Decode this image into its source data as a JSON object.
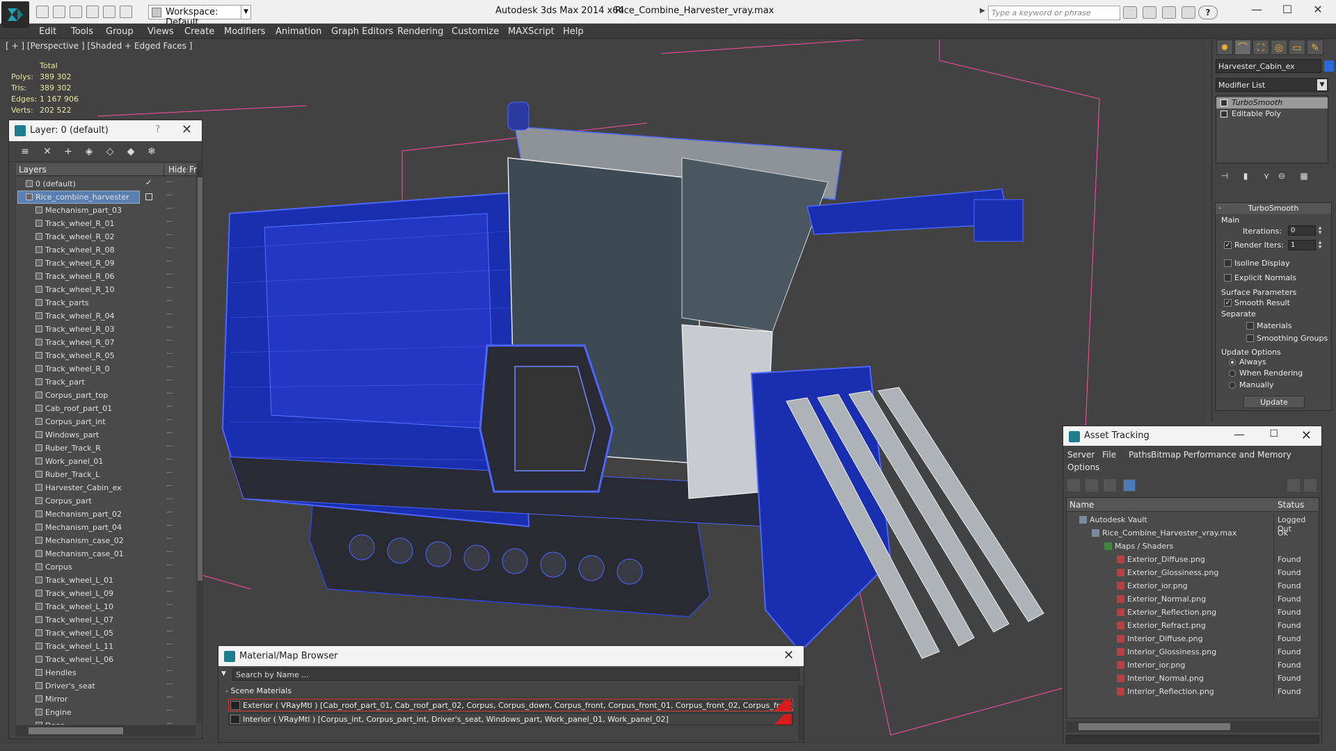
{
  "titlebar": {
    "workspace": "Workspace: Default",
    "app_title": "Autodesk 3ds Max  2014 x64",
    "file_name": "Rice_Combine_Harvester_vray.max",
    "search_placeholder": "Type a keyword or phrase",
    "help_label": "?"
  },
  "menu": [
    "Edit",
    "Tools",
    "Group",
    "Views",
    "Create",
    "Modifiers",
    "Animation",
    "Graph Editors",
    "Rendering",
    "Customize",
    "MAXScript",
    "Help"
  ],
  "viewport": {
    "label": "[ + ] [Perspective ] [Shaded + Edged Faces ]",
    "stats": {
      "header": "Total",
      "rows": [
        {
          "k": "Polys:",
          "v": "389 302"
        },
        {
          "k": "Tris:",
          "v": "389 302"
        },
        {
          "k": "Edges:",
          "v": "1 167 906"
        },
        {
          "k": "Verts:",
          "v": "202 522"
        }
      ]
    }
  },
  "layer_panel": {
    "title": "Layer: 0 (default)",
    "help": "?",
    "col_layers": "Layers",
    "col_hide": "Hide",
    "col_freeze": "Fr",
    "items": [
      {
        "label": "0 (default)",
        "level": 0,
        "checked": true
      },
      {
        "label": "Rice_combine_harvester",
        "level": 0,
        "selected": true
      },
      {
        "label": "Mechanism_part_03",
        "level": 1
      },
      {
        "label": "Track_wheel_R_01",
        "level": 1
      },
      {
        "label": "Track_wheel_R_02",
        "level": 1
      },
      {
        "label": "Track_wheel_R_08",
        "level": 1
      },
      {
        "label": "Track_wheel_R_09",
        "level": 1
      },
      {
        "label": "Track_wheel_R_06",
        "level": 1
      },
      {
        "label": "Track_wheel_R_10",
        "level": 1
      },
      {
        "label": "Track_parts",
        "level": 1
      },
      {
        "label": "Track_wheel_R_04",
        "level": 1
      },
      {
        "label": "Track_wheel_R_03",
        "level": 1
      },
      {
        "label": "Track_wheel_R_07",
        "level": 1
      },
      {
        "label": "Track_wheel_R_05",
        "level": 1
      },
      {
        "label": "Track_wheel_R_0",
        "level": 1
      },
      {
        "label": "Track_part",
        "level": 1
      },
      {
        "label": "Corpus_part_top",
        "level": 1
      },
      {
        "label": "Cab_roof_part_01",
        "level": 1
      },
      {
        "label": "Corpus_part_int",
        "level": 1
      },
      {
        "label": "Windows_part",
        "level": 1
      },
      {
        "label": "Ruber_Track_R",
        "level": 1
      },
      {
        "label": "Work_panel_01",
        "level": 1
      },
      {
        "label": "Ruber_Track_L",
        "level": 1
      },
      {
        "label": "Harvester_Cabin_ex",
        "level": 1
      },
      {
        "label": "Corpus_part",
        "level": 1
      },
      {
        "label": "Mechanism_part_02",
        "level": 1
      },
      {
        "label": "Mechanism_part_04",
        "level": 1
      },
      {
        "label": "Mechanism_case_02",
        "level": 1
      },
      {
        "label": "Mechanism_case_01",
        "level": 1
      },
      {
        "label": "Corpus",
        "level": 1
      },
      {
        "label": "Track_wheel_L_01",
        "level": 1
      },
      {
        "label": "Track_wheel_L_09",
        "level": 1
      },
      {
        "label": "Track_wheel_L_10",
        "level": 1
      },
      {
        "label": "Track_wheel_L_07",
        "level": 1
      },
      {
        "label": "Track_wheel_L_05",
        "level": 1
      },
      {
        "label": "Track_wheel_L_11",
        "level": 1
      },
      {
        "label": "Track_wheel_L_06",
        "level": 1
      },
      {
        "label": "Hendles",
        "level": 1
      },
      {
        "label": "Driver's_seat",
        "level": 1
      },
      {
        "label": "Mirror",
        "level": 1
      },
      {
        "label": "Engine",
        "level": 1
      },
      {
        "label": "Door",
        "level": 1
      }
    ]
  },
  "command_panel": {
    "object_name": "Harvester_Cabin_ex",
    "modifier_list": "Modifier List",
    "stack": [
      {
        "label": "TurboSmooth",
        "active": true
      },
      {
        "label": "Editable Poly",
        "active": false
      }
    ],
    "turbosmooth": {
      "title": "TurboSmooth",
      "main_group": "Main",
      "iterations_label": "Iterations:",
      "iterations_value": "0",
      "render_iters_label": "Render Iters:",
      "render_iters_value": "1",
      "isoline_label": "Isoline Display",
      "explicit_normals_label": "Explicit Normals",
      "surface_group": "Surface Parameters",
      "smooth_result_label": "Smooth Result",
      "separate_label": "Separate",
      "materials_label": "Materials",
      "smoothing_groups_label": "Smoothing Groups",
      "update_group": "Update Options",
      "always_label": "Always",
      "when_rendering_label": "When Rendering",
      "manually_label": "Manually",
      "update_button": "Update"
    }
  },
  "asset_tracking": {
    "title": "Asset Tracking",
    "menu": [
      "Server",
      "File",
      "Paths",
      "Bitmap Performance and Memory",
      "Options"
    ],
    "col_name": "Name",
    "col_status": "Status",
    "rows": [
      {
        "name": "Autodesk Vault",
        "status": "Logged Out",
        "indent": 1,
        "icon": "vault-icon"
      },
      {
        "name": "Rice_Combine_Harvester_vray.max",
        "status": "Ok",
        "indent": 2,
        "icon": "max-file-icon"
      },
      {
        "name": "Maps / Shaders",
        "status": "",
        "indent": 3,
        "icon": "maps-icon"
      },
      {
        "name": "Exterior_Diffuse.png",
        "status": "Found",
        "indent": 4,
        "icon": "png-icon"
      },
      {
        "name": "Exterior_Glossiness.png",
        "status": "Found",
        "indent": 4,
        "icon": "png-icon"
      },
      {
        "name": "Exterior_ior.png",
        "status": "Found",
        "indent": 4,
        "icon": "png-icon"
      },
      {
        "name": "Exterior_Normal.png",
        "status": "Found",
        "indent": 4,
        "icon": "png-icon"
      },
      {
        "name": "Exterior_Reflection.png",
        "status": "Found",
        "indent": 4,
        "icon": "png-icon"
      },
      {
        "name": "Exterior_Refract.png",
        "status": "Found",
        "indent": 4,
        "icon": "png-icon"
      },
      {
        "name": "Interior_Diffuse.png",
        "status": "Found",
        "indent": 4,
        "icon": "png-icon"
      },
      {
        "name": "Interior_Glossiness.png",
        "status": "Found",
        "indent": 4,
        "icon": "png-icon"
      },
      {
        "name": "Interior_ior.png",
        "status": "Found",
        "indent": 4,
        "icon": "png-icon"
      },
      {
        "name": "Interior_Normal.png",
        "status": "Found",
        "indent": 4,
        "icon": "png-icon"
      },
      {
        "name": "Interior_Reflection.png",
        "status": "Found",
        "indent": 4,
        "icon": "png-icon"
      }
    ]
  },
  "material_browser": {
    "title": "Material/Map Browser",
    "search_placeholder": "Search by Name ...",
    "group_title": "Scene Materials",
    "materials": [
      {
        "label": "Exterior ( VRayMtl ) [Cab_roof_part_01, Cab_roof_part_02, Corpus, Corpus_down, Corpus_front, Corpus_front_01, Corpus_front_02, Corpus_front_part,...",
        "selected": true
      },
      {
        "label": "Interior ( VRayMtl ) [Corpus_int, Corpus_part_int, Driver's_seat, Windows_part, Work_panel_01, Work_panel_02]",
        "selected": false
      }
    ]
  },
  "colors": {
    "model_blue": "#1a2fb0",
    "wire_blue": "#3a5cff",
    "cab_grey": "#9aa0a6",
    "selection_blue": "#5a7fb0",
    "bbox_pink": "#ff4fa0"
  }
}
